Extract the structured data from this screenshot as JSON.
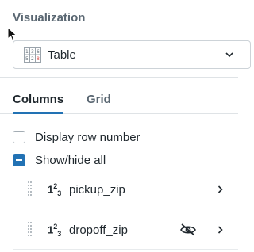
{
  "panel": {
    "section_label": "Visualization",
    "visualization_select": {
      "value": "Table",
      "icon": "table-icon"
    }
  },
  "tabs": [
    {
      "label": "Columns",
      "active": true
    },
    {
      "label": "Grid",
      "active": false
    }
  ],
  "options": {
    "display_row_number": {
      "label": "Display row number",
      "checked": false
    },
    "show_hide_all": {
      "label": "Show/hide all",
      "checked": "indeterminate"
    }
  },
  "columns": [
    {
      "name": "pickup_zip",
      "type_icon": "number-type-icon",
      "hidden": false
    },
    {
      "name": "dropoff_zip",
      "type_icon": "number-type-icon",
      "hidden": true
    }
  ],
  "colors": {
    "accent": "#2272b4",
    "text": "#1f272d",
    "muted": "#5a6772"
  }
}
